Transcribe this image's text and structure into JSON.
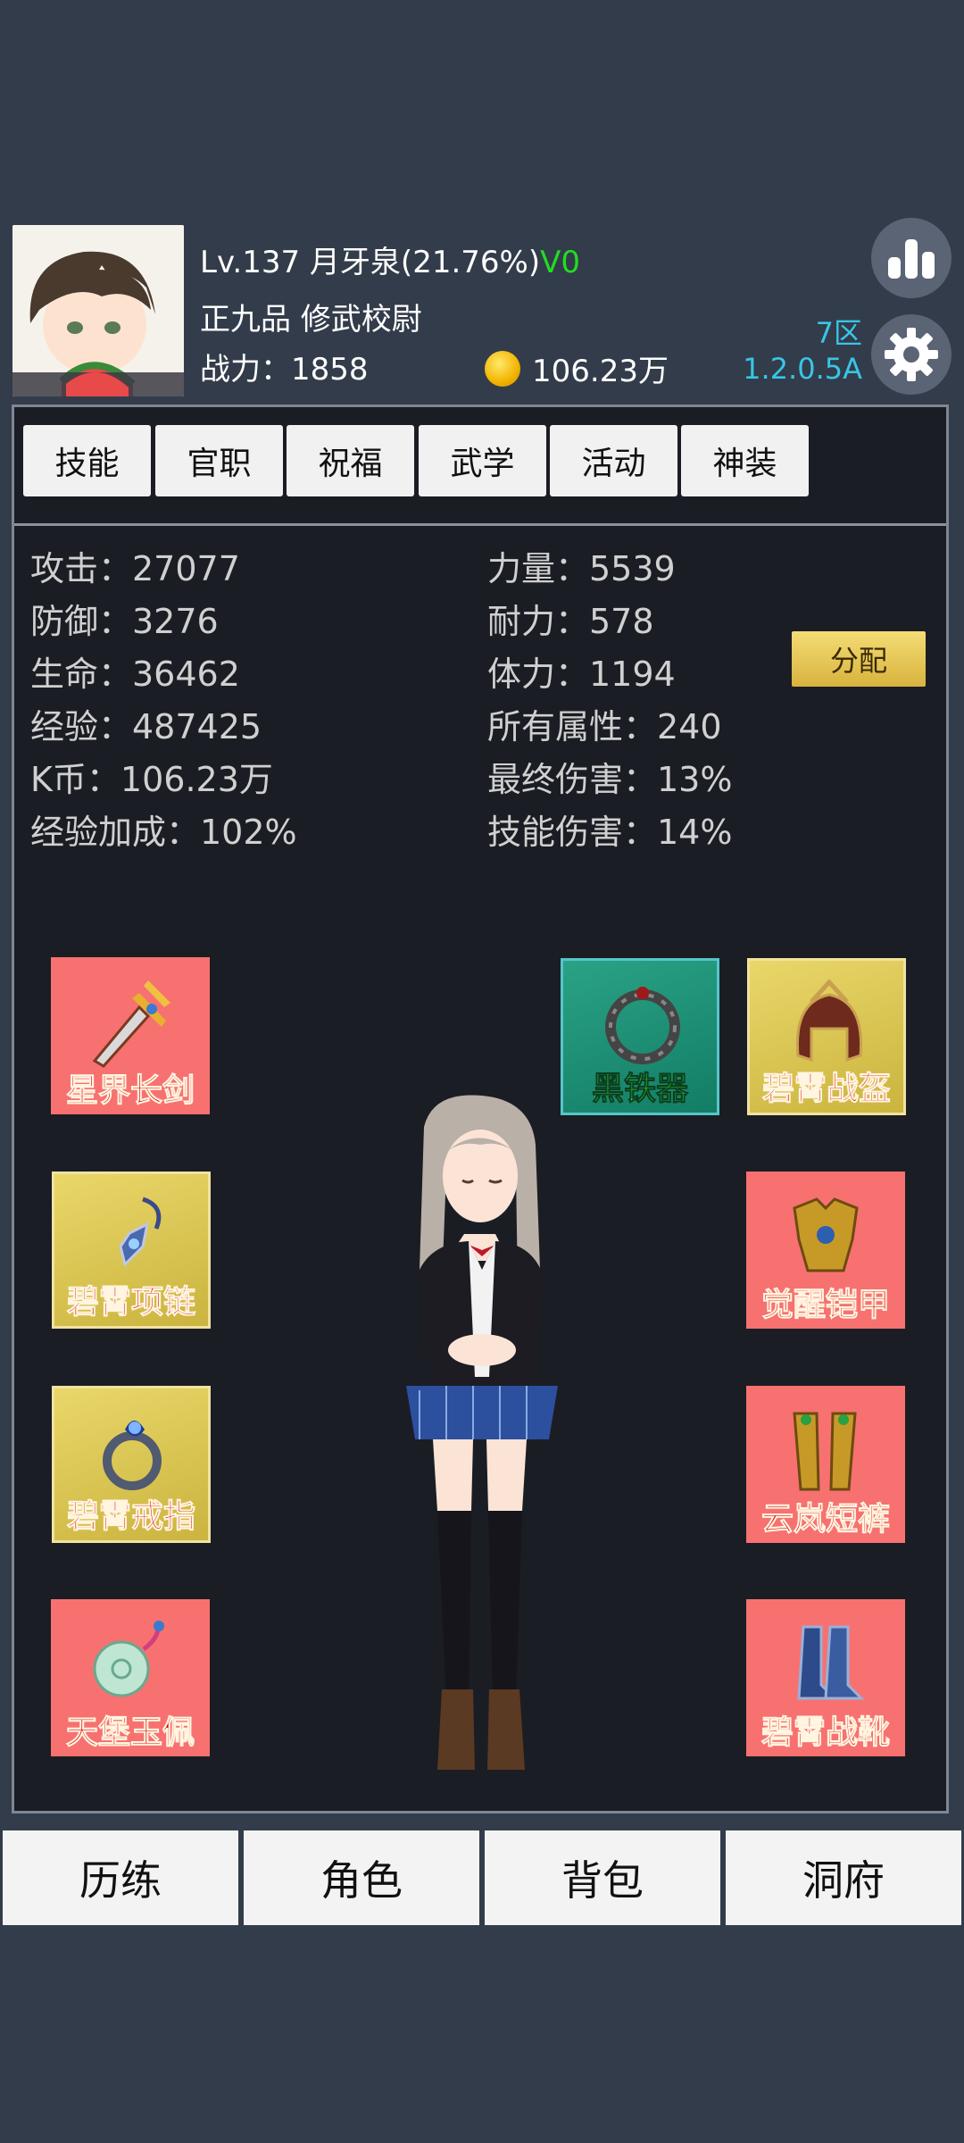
{
  "header": {
    "level_prefix": "Lv.137 月牙泉(21.76%)",
    "vip": "V0",
    "rank": "正九品 修武校尉",
    "power": "战力：1858",
    "coins": "106.23万",
    "server": "7区",
    "version": "1.2.0.5A"
  },
  "tabs": [
    "技能",
    "官职",
    "祝福",
    "武学",
    "活动",
    "神装"
  ],
  "stats_left": [
    "攻击：27077",
    "防御：3276",
    "生命：36462",
    "经验：487425",
    "K币：106.23万",
    "经验加成：102%"
  ],
  "stats_right": [
    "力量：5539",
    "耐力：578",
    "体力：1194",
    "所有属性：240",
    "最终伤害：13%",
    "技能伤害：14%"
  ],
  "allocate_label": "分配",
  "equipment": {
    "sword": "星界长剑",
    "black_iron": "黑铁器",
    "helmet": "碧霄战盔",
    "necklace": "碧霄项链",
    "armor": "觉醒铠甲",
    "ring": "碧霄戒指",
    "pants": "云岚短裤",
    "jade": "天堡玉佩",
    "boots": "碧霄战靴"
  },
  "nav": [
    "历练",
    "角色",
    "背包",
    "洞府"
  ],
  "colors": {
    "accent_cyan": "#37c6e6",
    "vip_green": "#22dd22",
    "slot_red": "#f77170",
    "slot_gold": "#e9d769",
    "slot_teal": "#2aa286"
  },
  "icons": [
    "bar-chart-icon",
    "gear-icon",
    "coin-icon"
  ]
}
